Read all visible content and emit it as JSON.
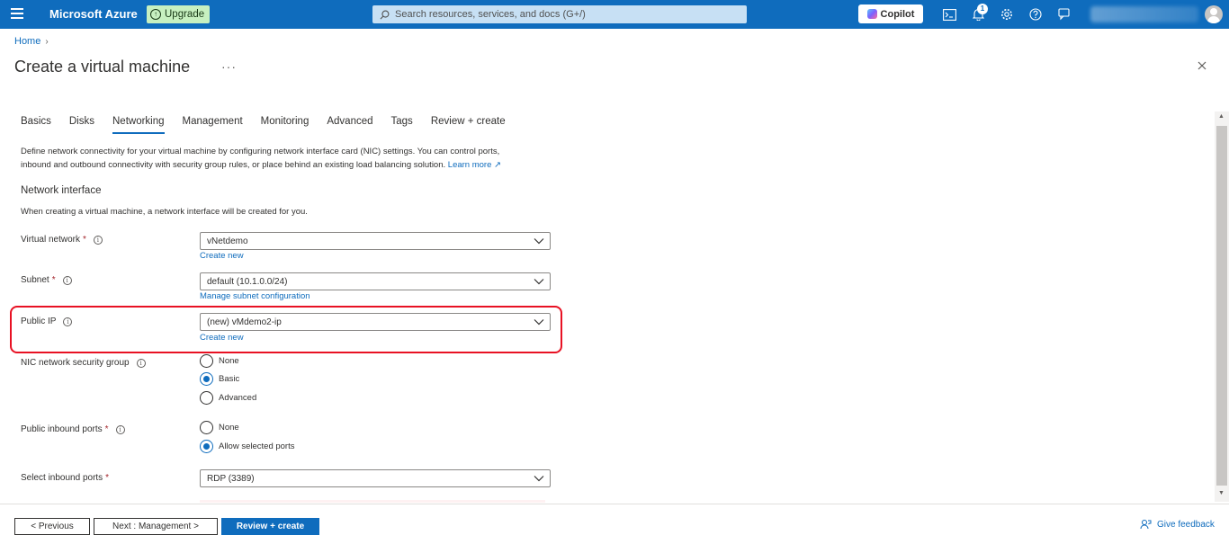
{
  "topbar": {
    "brand": "Microsoft Azure",
    "upgrade_label": "Upgrade",
    "search_placeholder": "Search resources, services, and docs (G+/)",
    "copilot_label": "Copilot",
    "notification_count": "1",
    "accent_color": "#0f6cbd"
  },
  "breadcrumb": {
    "home": "Home"
  },
  "page": {
    "title": "Create a virtual machine",
    "more": "···"
  },
  "tabs": [
    {
      "label": "Basics"
    },
    {
      "label": "Disks"
    },
    {
      "label": "Networking"
    },
    {
      "label": "Management"
    },
    {
      "label": "Monitoring"
    },
    {
      "label": "Advanced"
    },
    {
      "label": "Tags"
    },
    {
      "label": "Review + create"
    }
  ],
  "active_tab": "Networking",
  "description": {
    "line1": "Define network connectivity for your virtual machine by configuring network interface card (NIC) settings. You can control ports,",
    "line2": "inbound and outbound connectivity with security group rules, or place behind an existing load balancing solution.",
    "learn_more": "Learn more"
  },
  "network_interface": {
    "title": "Network interface",
    "desc": "When creating a virtual machine, a network interface will be created for you."
  },
  "fields": {
    "virtual_network": {
      "label": "Virtual network",
      "required": "*",
      "value": "vNetdemo",
      "link": "Create new"
    },
    "subnet": {
      "label": "Subnet",
      "required": "*",
      "value": "default (10.1.0.0/24)",
      "link": "Manage subnet configuration"
    },
    "public_ip": {
      "label": "Public IP",
      "value": "(new) vMdemo2-ip",
      "link": "Create new"
    },
    "nic_nsg": {
      "label": "NIC network security group",
      "options": [
        "None",
        "Basic",
        "Advanced"
      ],
      "selected": "Basic"
    },
    "public_inbound_ports": {
      "label": "Public inbound ports",
      "required": "*",
      "options": [
        "None",
        "Allow selected ports"
      ],
      "selected": "Allow selected ports"
    },
    "select_inbound_ports": {
      "label": "Select inbound ports",
      "required": "*",
      "value": "RDP (3389)"
    }
  },
  "footer": {
    "previous": "< Previous",
    "next": "Next : Management >",
    "review": "Review + create",
    "feedback": "Give feedback"
  }
}
